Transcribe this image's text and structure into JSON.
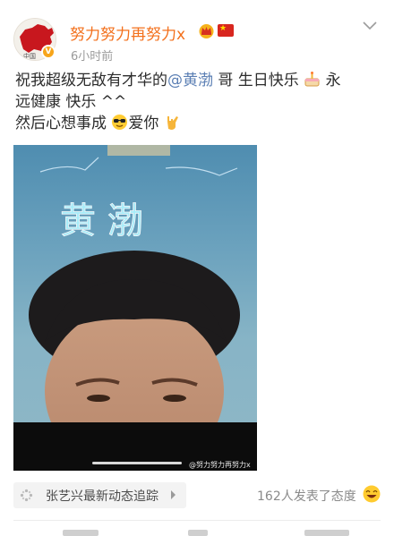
{
  "post": {
    "author": {
      "name": "努力努力再努力x",
      "time": "6小时前",
      "avatar_icon": "china-map-avatar",
      "verify_icon": "verified-v-icon",
      "badges": [
        "crown-badge-icon",
        "china-flag-icon"
      ]
    },
    "text": {
      "line1_a": "祝我超级无敌有才华的",
      "mention": "@黄渤",
      "line1_b": " 哥 生日快乐",
      "line1_c": " 永",
      "line2": "远健康 快乐 ^^",
      "line3_a": "然后心想事成",
      "line3_b": "爱你"
    },
    "image": {
      "neon_text": "黄  渤",
      "watermark": "@努力努力再努力x"
    },
    "topic": {
      "label": "张艺兴最新动态追踪",
      "icon": "topic-spark-icon"
    },
    "reactions": {
      "count_text": "162人发表了态度",
      "icon": "laughing-emoji-icon"
    }
  },
  "colors": {
    "username": "#f3701c",
    "mention": "#5b7fb4",
    "timestamp": "#9b9b9b",
    "neon": "#aef3ff"
  }
}
